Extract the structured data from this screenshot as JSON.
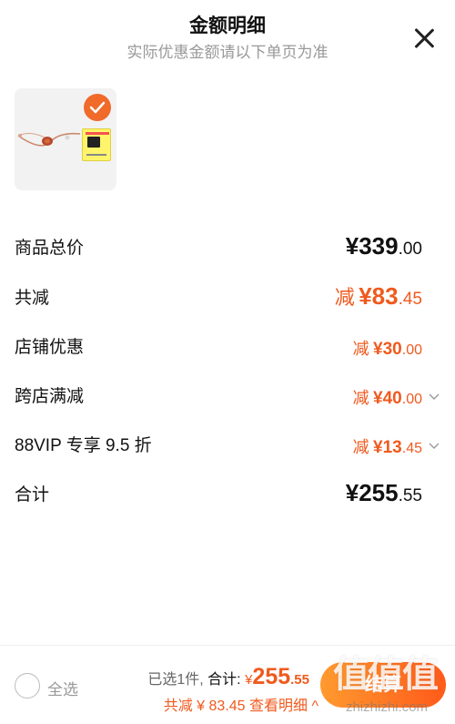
{
  "header": {
    "title": "金额明细",
    "subtitle": "实际优惠金额请以下单页为准"
  },
  "rows": [
    {
      "label": "商品总价",
      "prefix": "",
      "main": "¥339",
      "dec": ".00"
    },
    {
      "label": "共减",
      "prefix": "减",
      "main": "¥83",
      "dec": ".45"
    },
    {
      "label": "店铺优惠",
      "prefix": "减",
      "main": "¥30",
      "dec": ".00"
    },
    {
      "label": "跨店满减",
      "prefix": "减",
      "main": "¥40",
      "dec": ".00"
    },
    {
      "label": "88VIP 专享 9.5 折",
      "prefix": "减",
      "main": "¥13",
      "dec": ".45"
    },
    {
      "label": "合计",
      "prefix": "",
      "main": "¥255",
      "dec": ".55"
    }
  ],
  "bottom": {
    "select_all": "全选",
    "selected_count": "已选1件,",
    "total_label": "合计:",
    "yen": "¥",
    "total_int": "255",
    "total_dec": ".55",
    "saved": "共减 ¥ 83.45",
    "view_detail": "查看明细 ^",
    "checkout": "结算"
  },
  "watermark": {
    "glyphs": "值值值",
    "site": "zhizhizhi.com"
  },
  "colors": {
    "accent": "#f05a1e",
    "text": "#111111",
    "muted": "#999999"
  }
}
